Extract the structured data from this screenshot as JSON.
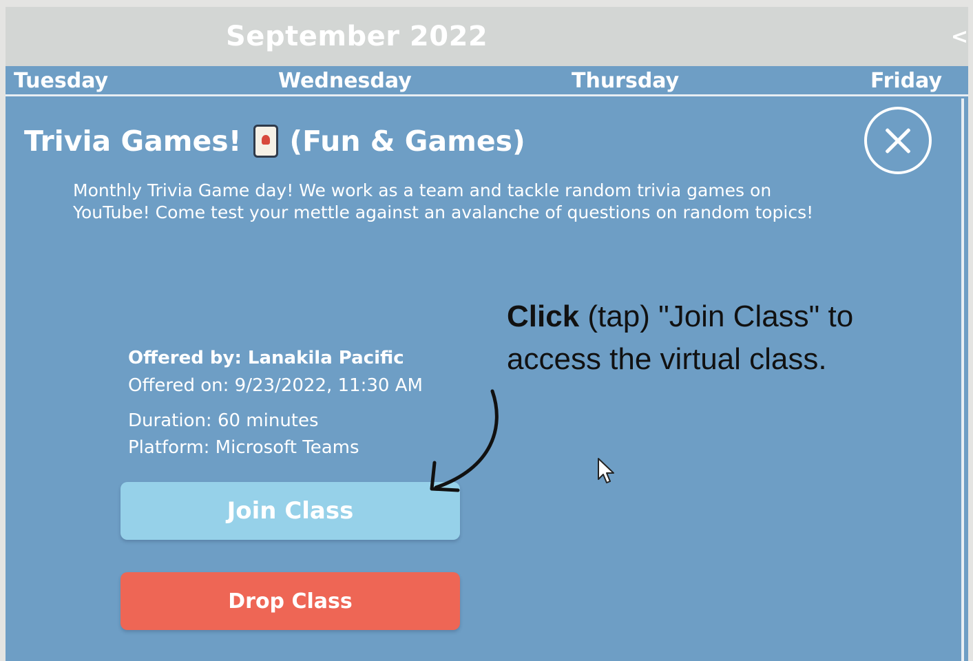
{
  "calendar": {
    "month_title": "September 2022",
    "nav_prev_glyph": "<",
    "days": [
      "Tuesday",
      "Wednesday",
      "Thursday",
      "Friday"
    ]
  },
  "event": {
    "title_main": "Trivia Games!",
    "title_icon": "playing-card-joker-icon",
    "title_category": "(Fun & Games)",
    "description": "Monthly Trivia Game day! We work as a team and tackle random trivia games on YouTube! Come test your mettle against an avalanche of questions on random topics!",
    "offered_by": "Offered by: Lanakila Pacific",
    "offered_on": "Offered on: 9/23/2022, 11:30 AM",
    "duration": "Duration: 60 minutes",
    "platform": "Platform: Microsoft Teams",
    "join_label": "Join Class",
    "drop_label": "Drop Class",
    "close_icon": "close-circle-icon"
  },
  "annotation": {
    "bold_part": "Click",
    "rest": " (tap) \"Join Class\" to access the virtual class."
  },
  "colors": {
    "panel_blue": "#6e9ec5",
    "header_gray": "#d3d6d4",
    "join_button": "#96d1e9",
    "drop_button": "#ee6655"
  }
}
